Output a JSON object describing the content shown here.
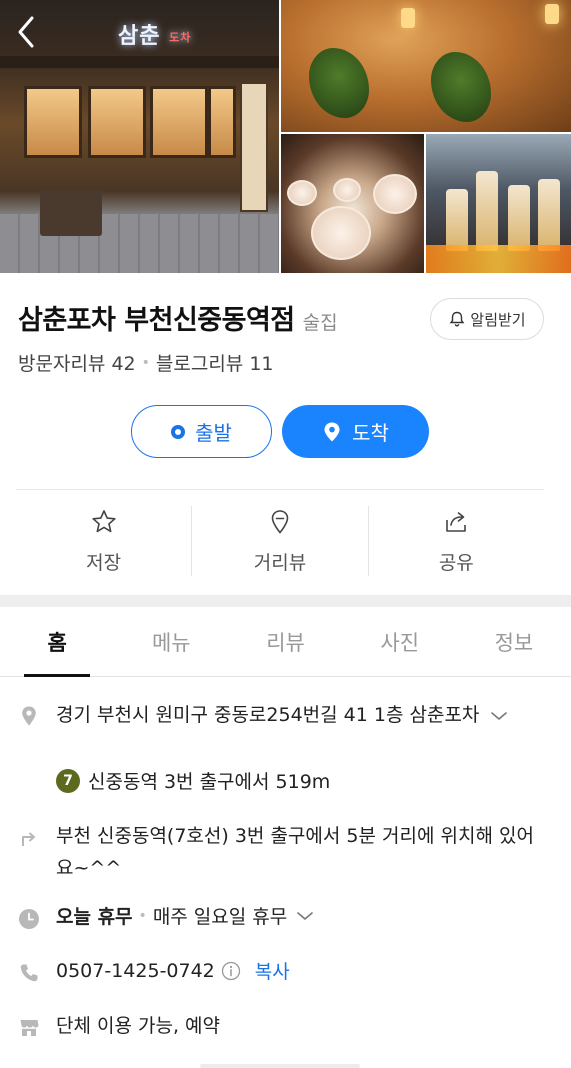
{
  "photos": {
    "main_sign_text": "삼춘",
    "main_sign_sub": "도차"
  },
  "place": {
    "name": "삼춘포차 부천신중동역점",
    "category": "술집",
    "notify_label": "알림받기",
    "visitor_reviews": "방문자리뷰 42",
    "blog_reviews": "블로그리뷰 11"
  },
  "route": {
    "depart_label": "출발",
    "arrive_label": "도착"
  },
  "actions": [
    {
      "label": "저장",
      "icon": "star-icon"
    },
    {
      "label": "거리뷰",
      "icon": "streetview-icon"
    },
    {
      "label": "공유",
      "icon": "share-icon"
    }
  ],
  "tabs": [
    {
      "label": "홈",
      "active": true
    },
    {
      "label": "메뉴",
      "active": false
    },
    {
      "label": "리뷰",
      "active": false
    },
    {
      "label": "사진",
      "active": false
    },
    {
      "label": "정보",
      "active": false
    }
  ],
  "info": {
    "address": "경기 부천시 원미구 중동로254번길 41 1층 삼춘포차",
    "subway_line": "7",
    "subway_line_color": "#5b6a1e",
    "subway_text": "신중동역 3번 출구에서 519m",
    "directions": "부천 신중동역(7호선) 3번 출구에서 5분 거리에 위치해 있어요~^^",
    "hours_status": "오늘 휴무",
    "hours_detail": "매주 일요일 휴무",
    "phone": "0507-1425-0742",
    "copy_label": "복사",
    "facility": "단체 이용 가능, 예약"
  },
  "colors": {
    "accent": "#1a84ff",
    "link": "#1a73e8"
  }
}
